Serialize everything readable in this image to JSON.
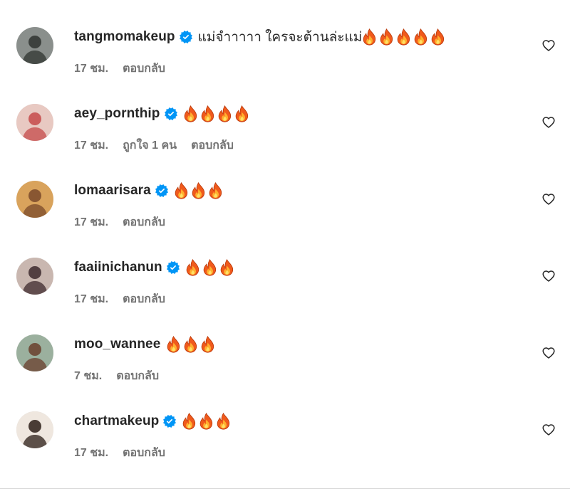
{
  "colors": {
    "text": "#262626",
    "secondary": "#737373",
    "verified": "#0095f6"
  },
  "comments": [
    {
      "username": "tangmomakeup",
      "verified": true,
      "text": "แม่จำาาาา ใครจะต้านล่ะแม่",
      "emoji_name": "fire-emoji",
      "emoji_count": 5,
      "time": "17 ชม.",
      "likes": "",
      "reply": "ตอบกลับ"
    },
    {
      "username": "aey_pornthip",
      "verified": true,
      "text": "",
      "emoji_name": "fire-emoji",
      "emoji_count": 4,
      "time": "17 ชม.",
      "likes": "ถูกใจ 1 คน",
      "reply": "ตอบกลับ"
    },
    {
      "username": "lomaarisara",
      "verified": true,
      "text": "",
      "emoji_name": "fire-emoji",
      "emoji_count": 3,
      "time": "17 ชม.",
      "likes": "",
      "reply": "ตอบกลับ"
    },
    {
      "username": "faaiinichanun",
      "verified": true,
      "text": "",
      "emoji_name": "fire-emoji",
      "emoji_count": 3,
      "time": "17 ชม.",
      "likes": "",
      "reply": "ตอบกลับ"
    },
    {
      "username": "moo_wannee",
      "verified": false,
      "text": "",
      "emoji_name": "fire-emoji",
      "emoji_count": 3,
      "time": "7 ชม.",
      "likes": "",
      "reply": "ตอบกลับ"
    },
    {
      "username": "chartmakeup",
      "verified": true,
      "text": "",
      "emoji_name": "fire-emoji",
      "emoji_count": 3,
      "time": "17 ชม.",
      "likes": "",
      "reply": "ตอบกลับ"
    }
  ]
}
